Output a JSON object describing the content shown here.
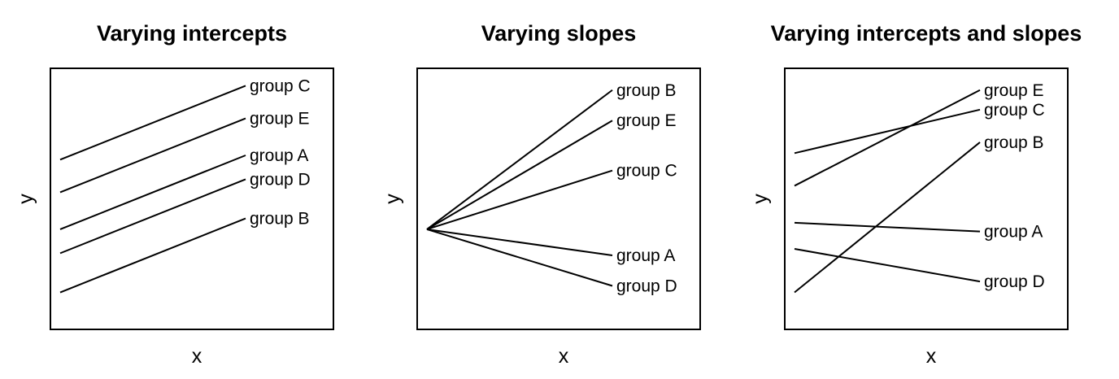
{
  "chart_data": [
    {
      "type": "line",
      "title": "Varying intercepts",
      "xlabel": "x",
      "ylabel": "y",
      "x_ticks_shown": false,
      "y_ticks_shown": false,
      "grid": false,
      "series": [
        {
          "name": "group C",
          "x": [
            0,
            1
          ],
          "y": [
            0.78,
            1.12
          ]
        },
        {
          "name": "group E",
          "x": [
            0,
            1
          ],
          "y": [
            0.63,
            0.97
          ]
        },
        {
          "name": "group A",
          "x": [
            0,
            1
          ],
          "y": [
            0.46,
            0.8
          ]
        },
        {
          "name": "group D",
          "x": [
            0,
            1
          ],
          "y": [
            0.35,
            0.69
          ]
        },
        {
          "name": "group B",
          "x": [
            0,
            1
          ],
          "y": [
            0.17,
            0.51
          ]
        }
      ]
    },
    {
      "type": "line",
      "title": "Varying slopes",
      "xlabel": "x",
      "ylabel": "y",
      "x_ticks_shown": false,
      "y_ticks_shown": false,
      "grid": false,
      "series": [
        {
          "name": "group B",
          "x": [
            0,
            1
          ],
          "y": [
            0.46,
            1.1
          ]
        },
        {
          "name": "group E",
          "x": [
            0,
            1
          ],
          "y": [
            0.46,
            0.96
          ]
        },
        {
          "name": "group C",
          "x": [
            0,
            1
          ],
          "y": [
            0.46,
            0.73
          ]
        },
        {
          "name": "group A",
          "x": [
            0,
            1
          ],
          "y": [
            0.46,
            0.34
          ]
        },
        {
          "name": "group D",
          "x": [
            0,
            1
          ],
          "y": [
            0.46,
            0.2
          ]
        }
      ]
    },
    {
      "type": "line",
      "title": "Varying intercepts and slopes",
      "xlabel": "x",
      "ylabel": "y",
      "x_ticks_shown": false,
      "y_ticks_shown": false,
      "grid": false,
      "series": [
        {
          "name": "group E",
          "x": [
            0,
            1
          ],
          "y": [
            0.66,
            1.1
          ]
        },
        {
          "name": "group C",
          "x": [
            0,
            1
          ],
          "y": [
            0.81,
            1.01
          ]
        },
        {
          "name": "group B",
          "x": [
            0,
            1
          ],
          "y": [
            0.17,
            0.86
          ]
        },
        {
          "name": "group A",
          "x": [
            0,
            1
          ],
          "y": [
            0.49,
            0.45
          ]
        },
        {
          "name": "group D",
          "x": [
            0,
            1
          ],
          "y": [
            0.37,
            0.22
          ]
        }
      ]
    }
  ]
}
